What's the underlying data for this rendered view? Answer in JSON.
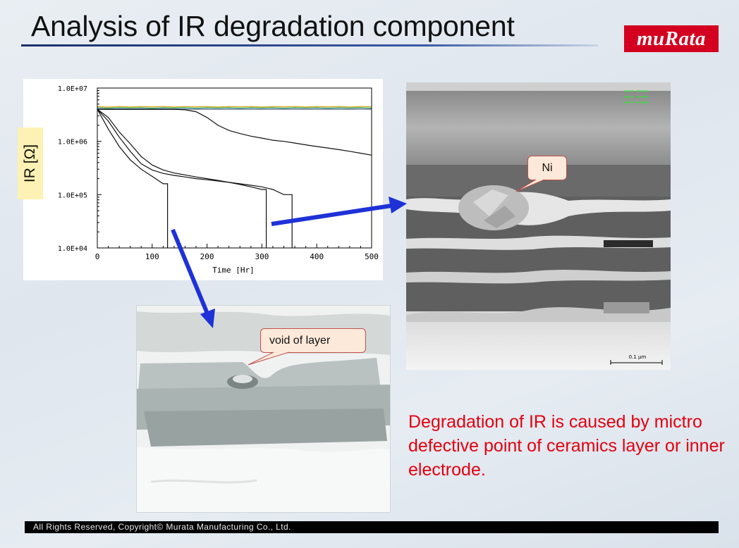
{
  "slide": {
    "title": "Analysis of IR degradation component",
    "logo_text": "muRata",
    "y_axis_label": "IR [Ω]",
    "callout_ni": "Ni",
    "callout_void": "void of layer",
    "conclusion": "Degradation of IR is caused by mictro defective point of ceramics layer or inner electrode.",
    "footer": "All Rights Reserved, Copyright© Murata Manufacturing Co., Ltd.",
    "sem_scale_text": "0.1 μm"
  },
  "colors": {
    "brand_red": "#d4001f",
    "conclusion_red": "#e3000f",
    "arrow_blue": "#1e32d8",
    "title_rule": "#1c2f6b",
    "callout_fill": "#fde9da",
    "callout_border": "#c0504d"
  },
  "chart_data": {
    "type": "line",
    "x": [
      0,
      20,
      40,
      60,
      80,
      100,
      120,
      140,
      160,
      180,
      200,
      220,
      240,
      260,
      280,
      300,
      320,
      340,
      360,
      380,
      400,
      420,
      440,
      460,
      480,
      500
    ],
    "xlabel": "Time [Hr]",
    "ylabel": "IR [Ω]",
    "xlim": [
      0,
      500
    ],
    "ylim": [
      10000,
      10000000
    ],
    "y_scale": "log",
    "x_ticks": [
      "0",
      "100",
      "200",
      "300",
      "400",
      "500"
    ],
    "y_ticks": [
      "1.0E+04",
      "1.0E+05",
      "1.0E+06",
      "1.0E+07"
    ],
    "x_tick_values": [
      0,
      100,
      200,
      300,
      400,
      500
    ],
    "y_tick_values": [
      10000,
      100000,
      1000000,
      10000000
    ],
    "grid": false,
    "series": [
      {
        "values": [
          4500000,
          4400000,
          4500000,
          4400000,
          4500000,
          4450000,
          4500000,
          4400000,
          4500000,
          4450000,
          4500000,
          4400000,
          4500000,
          4450000,
          4500000,
          4400000,
          4500000,
          4450000,
          4500000,
          4400000,
          4500000,
          4450000,
          4500000,
          4400000,
          4500000,
          4450000
        ],
        "color": "#d9a21b"
      },
      {
        "values": [
          4300000,
          4200000,
          4300000,
          4250000,
          4300000,
          4200000,
          4300000,
          4250000,
          4300000,
          4200000,
          4300000,
          4250000,
          4300000,
          4200000,
          4300000,
          4250000,
          4300000,
          4200000,
          4300000,
          4250000,
          4300000,
          4200000,
          4300000,
          4250000,
          4300000,
          4200000
        ],
        "color": "#46b04a"
      },
      {
        "values": [
          4100000,
          4050000,
          4100000,
          4050000,
          4100000,
          4050000,
          4100000,
          4050000,
          4100000,
          4050000,
          4100000,
          4050000,
          4100000,
          4050000,
          4100000,
          4050000,
          4100000,
          4050000,
          4100000,
          4050000,
          4100000,
          4050000,
          4100000,
          4050000,
          4100000,
          4050000
        ],
        "color": "#3a7bd5"
      },
      {
        "values": [
          4000000,
          3950000,
          4000000,
          3950000,
          4000000,
          3950000,
          4000000,
          3950000,
          4000000,
          3950000,
          4000000,
          3950000,
          4000000,
          3950000,
          4000000,
          3950000,
          4000000,
          3950000,
          4000000,
          3950000,
          4000000,
          3950000,
          4000000,
          3950000,
          4000000,
          3950000
        ],
        "color": "#9a9a9a"
      },
      {
        "values": [
          4000000,
          4000000,
          4000000,
          4000000,
          4000000,
          4000000,
          4000000,
          4000000,
          3900000,
          3600000,
          2800000,
          2000000,
          1600000,
          1400000,
          1250000,
          1150000,
          1050000,
          1000000,
          930000,
          860000,
          800000,
          750000,
          700000,
          650000,
          600000,
          550000
        ],
        "color": "#111111"
      },
      {
        "values": [
          4000000,
          1700000,
          800000,
          450000,
          300000,
          220000,
          160000,
          110000,
          60000,
          32000,
          30000,
          29000,
          28000,
          27000,
          26000,
          25000,
          24000,
          23000,
          22000,
          21000,
          20000,
          19000,
          18000,
          17000,
          16000,
          15000
        ],
        "color": "#111111",
        "end_x": 128
      },
      {
        "values": [
          4000000,
          2400000,
          1200000,
          650000,
          380000,
          290000,
          250000,
          230000,
          215000,
          200000,
          190000,
          180000,
          170000,
          160000,
          150000,
          140000,
          125000,
          100000,
          60000,
          40000,
          38000,
          36000,
          34000,
          32000,
          30000,
          28000
        ],
        "color": "#111111",
        "end_x": 355
      },
      {
        "values": [
          4000000,
          2800000,
          1500000,
          900000,
          520000,
          360000,
          290000,
          255000,
          235000,
          215000,
          200000,
          185000,
          170000,
          155000,
          140000,
          125000,
          110000,
          95000,
          80000,
          65000,
          55000,
          50000,
          46000,
          42000,
          38000,
          35000
        ],
        "color": "#111111",
        "end_x": 308
      }
    ]
  }
}
